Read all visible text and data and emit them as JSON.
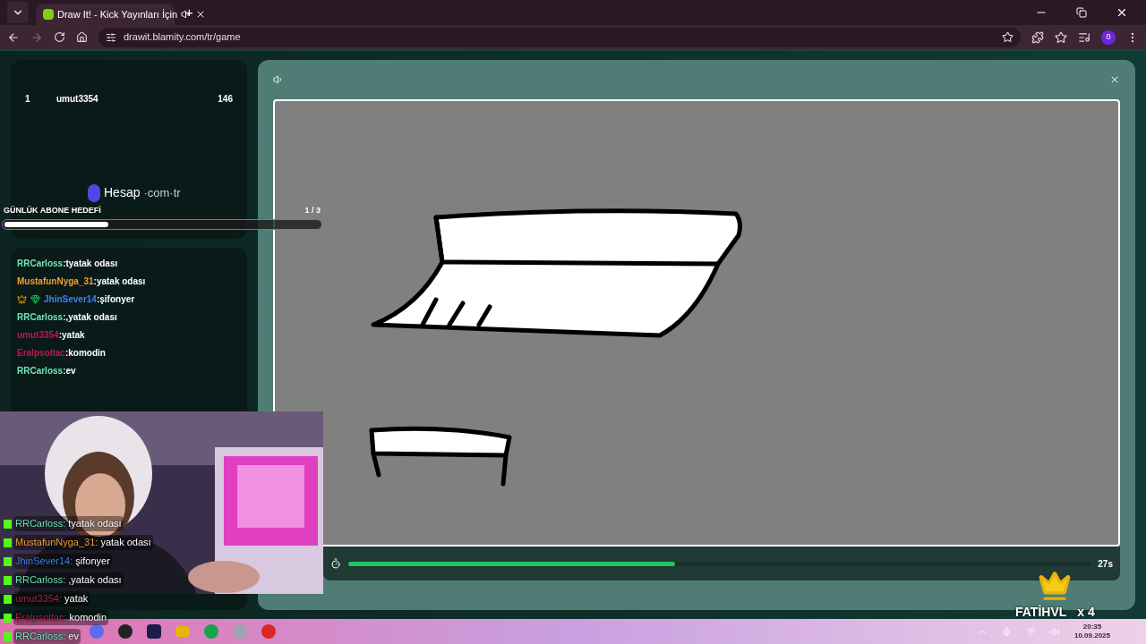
{
  "browser": {
    "tab_title": "Draw It! - Kick Yayınları İçin",
    "new_tab": "+",
    "url": "drawit.blamity.com/tr/game",
    "profile": "0"
  },
  "leaderboard": [
    {
      "rank": "1",
      "name": "umut3354",
      "score": "146"
    }
  ],
  "sponsor": {
    "name": "Hesap",
    "domain": "·com·tr"
  },
  "goal": {
    "label": "GÜNLÜK ABONE HEDEFİ",
    "count": "1 / 3",
    "level": 0.33
  },
  "chat": [
    {
      "user": "RRCarloss",
      "message": ":tyatak odası",
      "color": "#6ee7b7",
      "badges": false
    },
    {
      "user": "MustafunNyga_31",
      "message": ":yatak odası",
      "color": "#f0a030",
      "badges": false
    },
    {
      "user": "JhinSever14",
      "message": ":şifonyer",
      "color": "#3b82f6",
      "badges": true
    },
    {
      "user": "RRCarloss",
      "message": ":,yatak odası",
      "color": "#6ee7b7",
      "badges": false
    },
    {
      "user": "umut3354",
      "message": ":yatak",
      "color": "#c0164a",
      "badges": false
    },
    {
      "user": "Eralpsoltac",
      "message": ":komodin",
      "color": "#c0164a",
      "badges": false
    },
    {
      "user": "RRCarloss",
      "message": ":ev",
      "color": "#6ee7b7",
      "badges": false
    }
  ],
  "overlay_chat": [
    {
      "user": "RRCarloss:",
      "message": "tyatak odası",
      "color": "#6ee7b7"
    },
    {
      "user": "MustafunNyga_31:",
      "message": "yatak odası",
      "color": "#f0a030"
    },
    {
      "user": "JhinSever14:",
      "message": "şifonyer",
      "color": "#3b82f6"
    },
    {
      "user": "RRCarloss:",
      "message": ",yatak odası",
      "color": "#6ee7b7"
    },
    {
      "user": "umut3354:",
      "message": "yatak",
      "color": "#c0164a"
    },
    {
      "user": "Eralpsoltac:",
      "message": "komodin",
      "color": "#c0164a"
    },
    {
      "user": "RRCarloss:",
      "message": "ev",
      "color": "#6ee7b7"
    }
  ],
  "game": {
    "timer": "27s",
    "level": 0.44
  },
  "sub_alert": {
    "name": "FATİHVL",
    "count": "x 4"
  },
  "clock": {
    "time": "20:35",
    "date": "10.09.2025"
  }
}
